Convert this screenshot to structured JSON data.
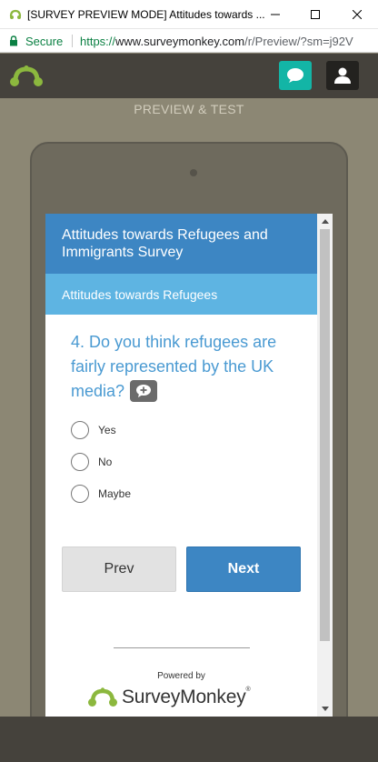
{
  "window": {
    "title": "[SURVEY PREVIEW MODE] Attitudes towards ...",
    "secure_label": "Secure",
    "url_scheme": "https://",
    "url_host": "www.surveymonkey.com",
    "url_path": "/r/Preview/?sm=j92V"
  },
  "toolbar": {
    "preview_label": "PREVIEW & TEST"
  },
  "survey": {
    "title": "Attitudes towards Refugees and Immigrants Survey",
    "page_title": "Attitudes towards Refugees",
    "question_number": "4.",
    "question_text": "Do you think refugees are fairly represented by the UK media?",
    "options": [
      {
        "label": "Yes",
        "selected": false
      },
      {
        "label": "No",
        "selected": false
      },
      {
        "label": "Maybe",
        "selected": false
      }
    ],
    "prev_label": "Prev",
    "next_label": "Next"
  },
  "footer": {
    "powered_by": "Powered by",
    "brand": "SurveyMonkey"
  },
  "colors": {
    "header_blue": "#3d86c3",
    "page_blue": "#5eb4e2",
    "question_blue": "#4a9ad2",
    "chat_teal": "#13b5a6",
    "brand_green": "#8cb83e"
  }
}
